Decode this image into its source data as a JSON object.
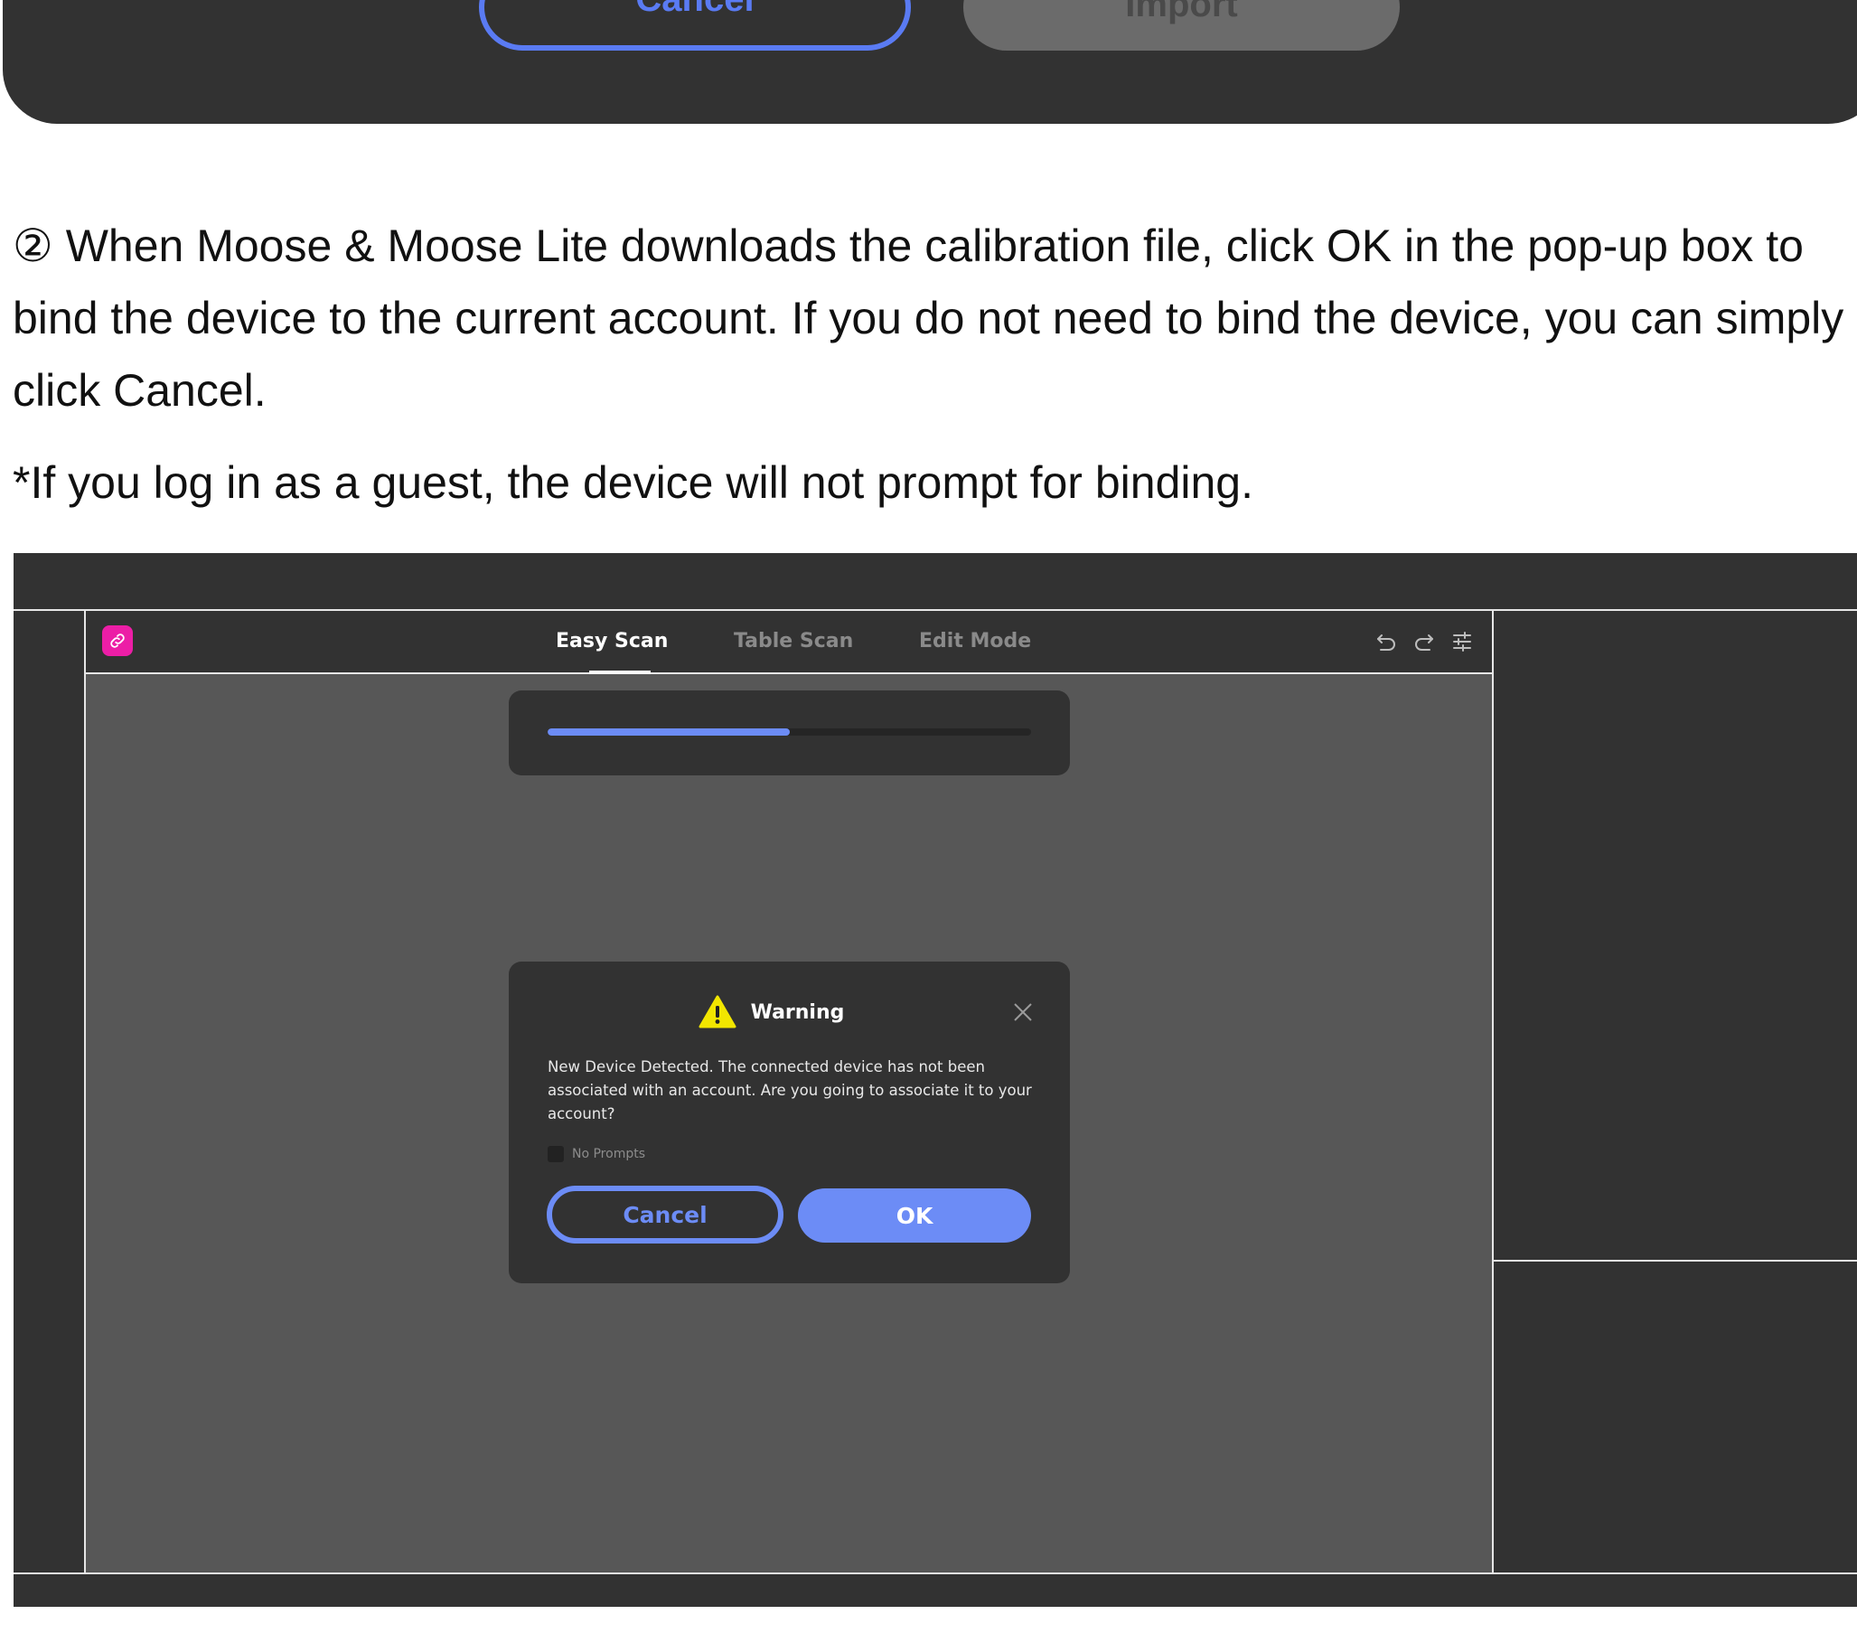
{
  "previous_dialog": {
    "cancel_label": "Cancel",
    "import_label": "Import"
  },
  "instructions": {
    "step_marker": "②",
    "paragraph": " When Moose & Moose Lite downloads the calibration file, click OK in the pop-up box to bind the device to the current account. If you do not need to bind the device, you can simply click Cancel.",
    "note": "*If you log in as a guest, the device will not prompt for binding."
  },
  "app": {
    "logo_icon": "link-icon",
    "tabs": [
      {
        "label": "Easy Scan",
        "active": true
      },
      {
        "label": "Table Scan",
        "active": false
      },
      {
        "label": "Edit Mode",
        "active": false
      }
    ],
    "toolbar_icons": [
      "undo-icon",
      "redo-icon",
      "settings-sliders-icon"
    ],
    "progress": 0.5,
    "colors": {
      "accent": "#6c8cf6",
      "logo": "#ec1ea6",
      "warning": "#f2e600",
      "panel": "#323232",
      "canvas": "#575757"
    }
  },
  "dialog": {
    "title": "Warning",
    "icon": "warning-icon",
    "message": "New Device Detected. The connected device has not been associated with an account. Are you going to associate it to your account?",
    "checkbox_label": "No Prompts",
    "checkbox_checked": false,
    "cancel_label": "Cancel",
    "ok_label": "OK"
  }
}
